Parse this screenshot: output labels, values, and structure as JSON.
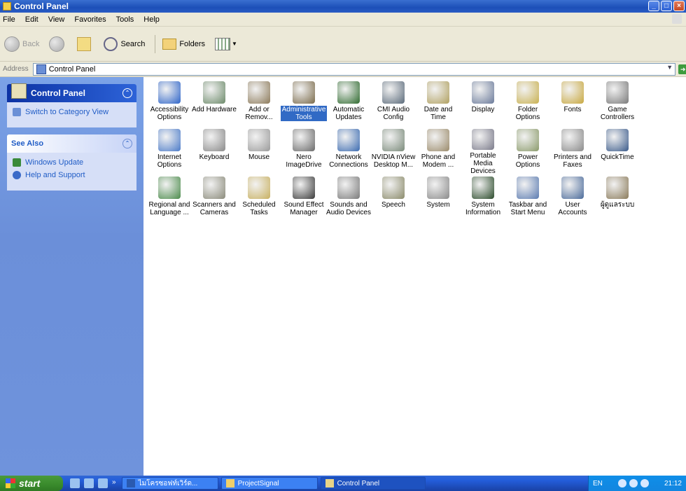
{
  "window": {
    "title": "Control Panel",
    "buttons": {
      "minimize": "_",
      "maximize": "□",
      "close": "×"
    }
  },
  "menu": [
    "File",
    "Edit",
    "View",
    "Favorites",
    "Tools",
    "Help"
  ],
  "toolbar": {
    "back_label": "Back",
    "search_label": "Search",
    "folders_label": "Folders"
  },
  "address": {
    "label": "Address",
    "value": "Control Panel",
    "go_label": "Go"
  },
  "left_pane": {
    "control_panel": {
      "title": "Control Panel",
      "link": "Switch to Category View"
    },
    "see_also": {
      "title": "See Also",
      "links": [
        "Windows Update",
        "Help and Support"
      ]
    }
  },
  "items": [
    {
      "label": "Accessibility Options",
      "icon": "accessibility-icon",
      "color": "#2c63c8"
    },
    {
      "label": "Add Hardware",
      "icon": "hardware-icon",
      "color": "#6c8a6a"
    },
    {
      "label": "Add or Remov...",
      "icon": "add-remove-icon",
      "color": "#8c7a5a"
    },
    {
      "label": "Administrative Tools",
      "icon": "admin-tools-icon",
      "color": "#7a6a4a",
      "selected": true
    },
    {
      "label": "Automatic Updates",
      "icon": "globe-icon",
      "color": "#2e6a2e"
    },
    {
      "label": "CMI Audio Config",
      "icon": "audio-config-icon",
      "color": "#5a6a7a"
    },
    {
      "label": "Date and Time",
      "icon": "clock-icon",
      "color": "#b0a060"
    },
    {
      "label": "Display",
      "icon": "display-icon",
      "color": "#6a7a9a"
    },
    {
      "label": "Folder Options",
      "icon": "folder-options-icon",
      "color": "#c8b050"
    },
    {
      "label": "Fonts",
      "icon": "fonts-icon",
      "color": "#c8a840"
    },
    {
      "label": "Game Controllers",
      "icon": "gamepad-icon",
      "color": "#7a7a7a"
    },
    {
      "label": "Internet Options",
      "icon": "internet-icon",
      "color": "#4a7ac8"
    },
    {
      "label": "Keyboard",
      "icon": "keyboard-icon",
      "color": "#8a8a8a"
    },
    {
      "label": "Mouse",
      "icon": "mouse-icon",
      "color": "#9a9a9a"
    },
    {
      "label": "Nero ImageDrive",
      "icon": "nero-icon",
      "color": "#6a6a6a"
    },
    {
      "label": "Network Connections",
      "icon": "network-icon",
      "color": "#3a6ab0"
    },
    {
      "label": "NVIDIA nView Desktop M...",
      "icon": "nview-icon",
      "color": "#7a8a7a"
    },
    {
      "label": "Phone and Modem ...",
      "icon": "phone-icon",
      "color": "#9a8a6a"
    },
    {
      "label": "Portable Media Devices",
      "icon": "media-device-icon",
      "color": "#7a7a8a"
    },
    {
      "label": "Power Options",
      "icon": "power-icon",
      "color": "#8a9a6a"
    },
    {
      "label": "Printers and Faxes",
      "icon": "printer-icon",
      "color": "#8a8a8a"
    },
    {
      "label": "QuickTime",
      "icon": "quicktime-icon",
      "color": "#3a5a8a"
    },
    {
      "label": "Regional and Language ...",
      "icon": "regional-icon",
      "color": "#4a8a4a"
    },
    {
      "label": "Scanners and Cameras",
      "icon": "scanner-icon",
      "color": "#8a8a7a"
    },
    {
      "label": "Scheduled Tasks",
      "icon": "scheduled-icon",
      "color": "#c8b060"
    },
    {
      "label": "Sound Effect Manager",
      "icon": "sound-effect-icon",
      "color": "#3a3a3a"
    },
    {
      "label": "Sounds and Audio Devices",
      "icon": "speaker-icon",
      "color": "#7a7a7a"
    },
    {
      "label": "Speech",
      "icon": "speech-icon",
      "color": "#8a8a6a"
    },
    {
      "label": "System",
      "icon": "system-icon",
      "color": "#8a8a8a"
    },
    {
      "label": "System Information",
      "icon": "system-info-icon",
      "color": "#2a4a2a"
    },
    {
      "label": "Taskbar and Start Menu",
      "icon": "taskbar-icon",
      "color": "#5a7ab0"
    },
    {
      "label": "User Accounts",
      "icon": "user-accounts-icon",
      "color": "#4a6a9a"
    },
    {
      "label": "ผู้ดูแลระบบ",
      "icon": "globe-small-icon",
      "color": "#8a7a5a"
    }
  ],
  "taskbar": {
    "start_label": "start",
    "more": "»",
    "tasks": [
      {
        "label": "ไมโครซอฟท์เวิร์ด...",
        "icon": "word-icon"
      },
      {
        "label": "ProjectSignal",
        "icon": "folder-icon"
      },
      {
        "label": "Control Panel",
        "icon": "control-panel-icon",
        "active": true
      }
    ],
    "tray": {
      "lang": "EN",
      "clock": "21:12"
    }
  }
}
